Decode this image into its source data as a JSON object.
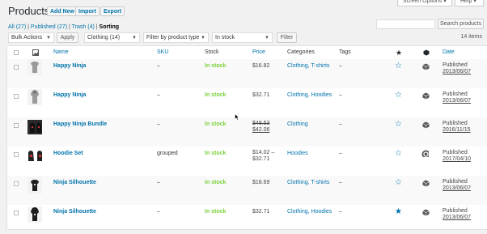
{
  "screen_options": {
    "label": "Screen Options ▾"
  },
  "help": {
    "label": "Help ▾"
  },
  "page_title": "Products",
  "title_buttons": {
    "add_new": "Add New",
    "import": "Import",
    "export": "Export"
  },
  "views": {
    "all": "All (27)",
    "published": "Published (27)",
    "trash": "Trash (4)",
    "sorting": "Sorting",
    "sep": "|"
  },
  "search": {
    "value": "",
    "button": "Search products"
  },
  "filters": {
    "bulk_actions": "Bulk Actions",
    "apply": "Apply",
    "category": "Clothing  (14)",
    "product_type": "Filter by product type",
    "stock": "In stock",
    "filter": "Filter",
    "items_count": "14 items"
  },
  "columns": {
    "name": "Name",
    "sku": "SKU",
    "stock": "Stock",
    "price": "Price",
    "categories": "Categories",
    "tags": "Tags",
    "date": "Date"
  },
  "icons": {
    "image_col": "image-icon",
    "featured_col": "star-icon",
    "type_col": "cube-icon"
  },
  "rows": [
    {
      "name": "Happy Ninja",
      "sku": "–",
      "stock": "In stock",
      "price_line1": "$16.82",
      "price_line2": "",
      "price_style": "plain",
      "categories": "Clothing, T-shirts",
      "tags": "–",
      "featured": false,
      "type": "simple",
      "status": "Published",
      "date": "2013/06/07",
      "thumb": "tshirt-gray"
    },
    {
      "name": "Happy Ninja",
      "sku": "–",
      "stock": "In stock",
      "price_line1": "$32.71",
      "price_line2": "",
      "price_style": "plain",
      "categories": "Clothing, Hoodies",
      "tags": "–",
      "featured": false,
      "type": "simple",
      "status": "Published",
      "date": "2013/06/07",
      "thumb": "hoodie-gray"
    },
    {
      "name": "Happy Ninja Bundle",
      "sku": "–",
      "stock": "In stock",
      "price_line1": "$49.53",
      "price_line2": "$42.06",
      "price_style": "sale",
      "categories": "Clothing",
      "tags": "–",
      "featured": false,
      "type": "simple",
      "status": "Published",
      "date": "2016/11/15",
      "thumb": "bundle"
    },
    {
      "name": "Hoodie Set",
      "sku": "grouped",
      "stock": "In stock",
      "price_line1": "$14.02 –",
      "price_line2": "$32.71",
      "price_style": "range",
      "categories": "Hoodies",
      "tags": "–",
      "featured": false,
      "type": "grouped",
      "status": "Published",
      "date": "2017/04/10",
      "thumb": "hoodie-set"
    },
    {
      "name": "Ninja Silhouette",
      "sku": "–",
      "stock": "In stock",
      "price_line1": "$18.69",
      "price_line2": "",
      "price_style": "plain",
      "categories": "Clothing, T-shirts",
      "tags": "–",
      "featured": false,
      "type": "simple",
      "status": "Published",
      "date": "2013/06/07",
      "thumb": "tshirt-black"
    },
    {
      "name": "Ninja Silhouette",
      "sku": "–",
      "stock": "In stock",
      "price_line1": "$32.71",
      "price_line2": "",
      "price_style": "plain",
      "categories": "Clothing, Hoodies",
      "tags": "–",
      "featured": true,
      "type": "simple",
      "status": "Published",
      "date": "2013/06/07",
      "thumb": "hoodie-black"
    }
  ],
  "colors": {
    "link": "#0073aa",
    "in_stock": "#7ad03a",
    "page_bg": "#f1f1f1"
  }
}
